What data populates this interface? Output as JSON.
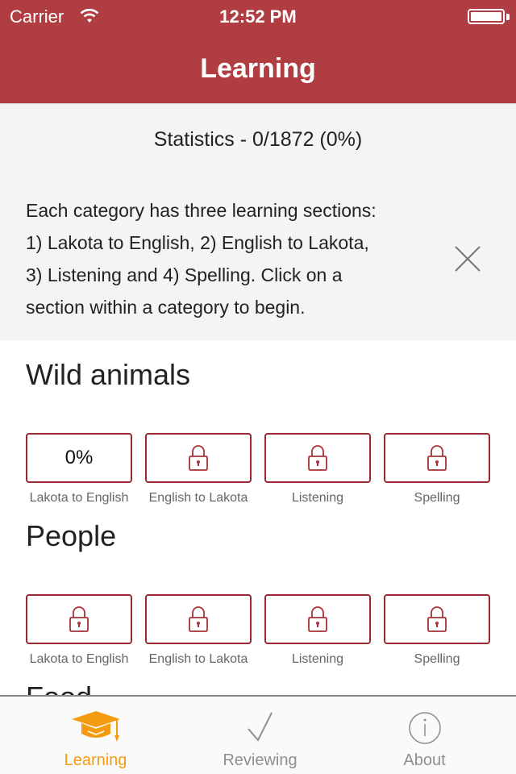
{
  "colors": {
    "brand": "#b03d42",
    "tile_border": "#9a2a2f",
    "tab_active": "#f39c12",
    "tab_inactive": "#8e8e8e"
  },
  "status_bar": {
    "carrier": "Carrier",
    "time": "12:52 PM",
    "wifi_icon": "wifi-icon",
    "battery_icon": "battery-icon"
  },
  "nav": {
    "title": "Learning"
  },
  "info": {
    "statistics": "Statistics - 0/1872 (0%)",
    "lines": [
      "Each category has three learning sections:",
      "1) Lakota to English, 2) English to Lakota,",
      "3) Listening and 4) Spelling. Click on a",
      "section within a category to begin."
    ],
    "close_icon": "close-icon"
  },
  "categories": [
    {
      "title": "Wild animals",
      "sections": [
        {
          "label": "Lakota to English",
          "state": "unlocked",
          "progress": "0%"
        },
        {
          "label": "English to Lakota",
          "state": "locked"
        },
        {
          "label": "Listening",
          "state": "locked"
        },
        {
          "label": "Spelling",
          "state": "locked"
        }
      ]
    },
    {
      "title": "People",
      "sections": [
        {
          "label": "Lakota to English",
          "state": "locked"
        },
        {
          "label": "English to Lakota",
          "state": "locked"
        },
        {
          "label": "Listening",
          "state": "locked"
        },
        {
          "label": "Spelling",
          "state": "locked"
        }
      ]
    },
    {
      "title": "Food"
    }
  ],
  "tabs": [
    {
      "label": "Learning",
      "icon": "graduation-cap-icon",
      "active": true
    },
    {
      "label": "Reviewing",
      "icon": "checkmark-icon",
      "active": false
    },
    {
      "label": "About",
      "icon": "info-icon",
      "active": false
    }
  ]
}
